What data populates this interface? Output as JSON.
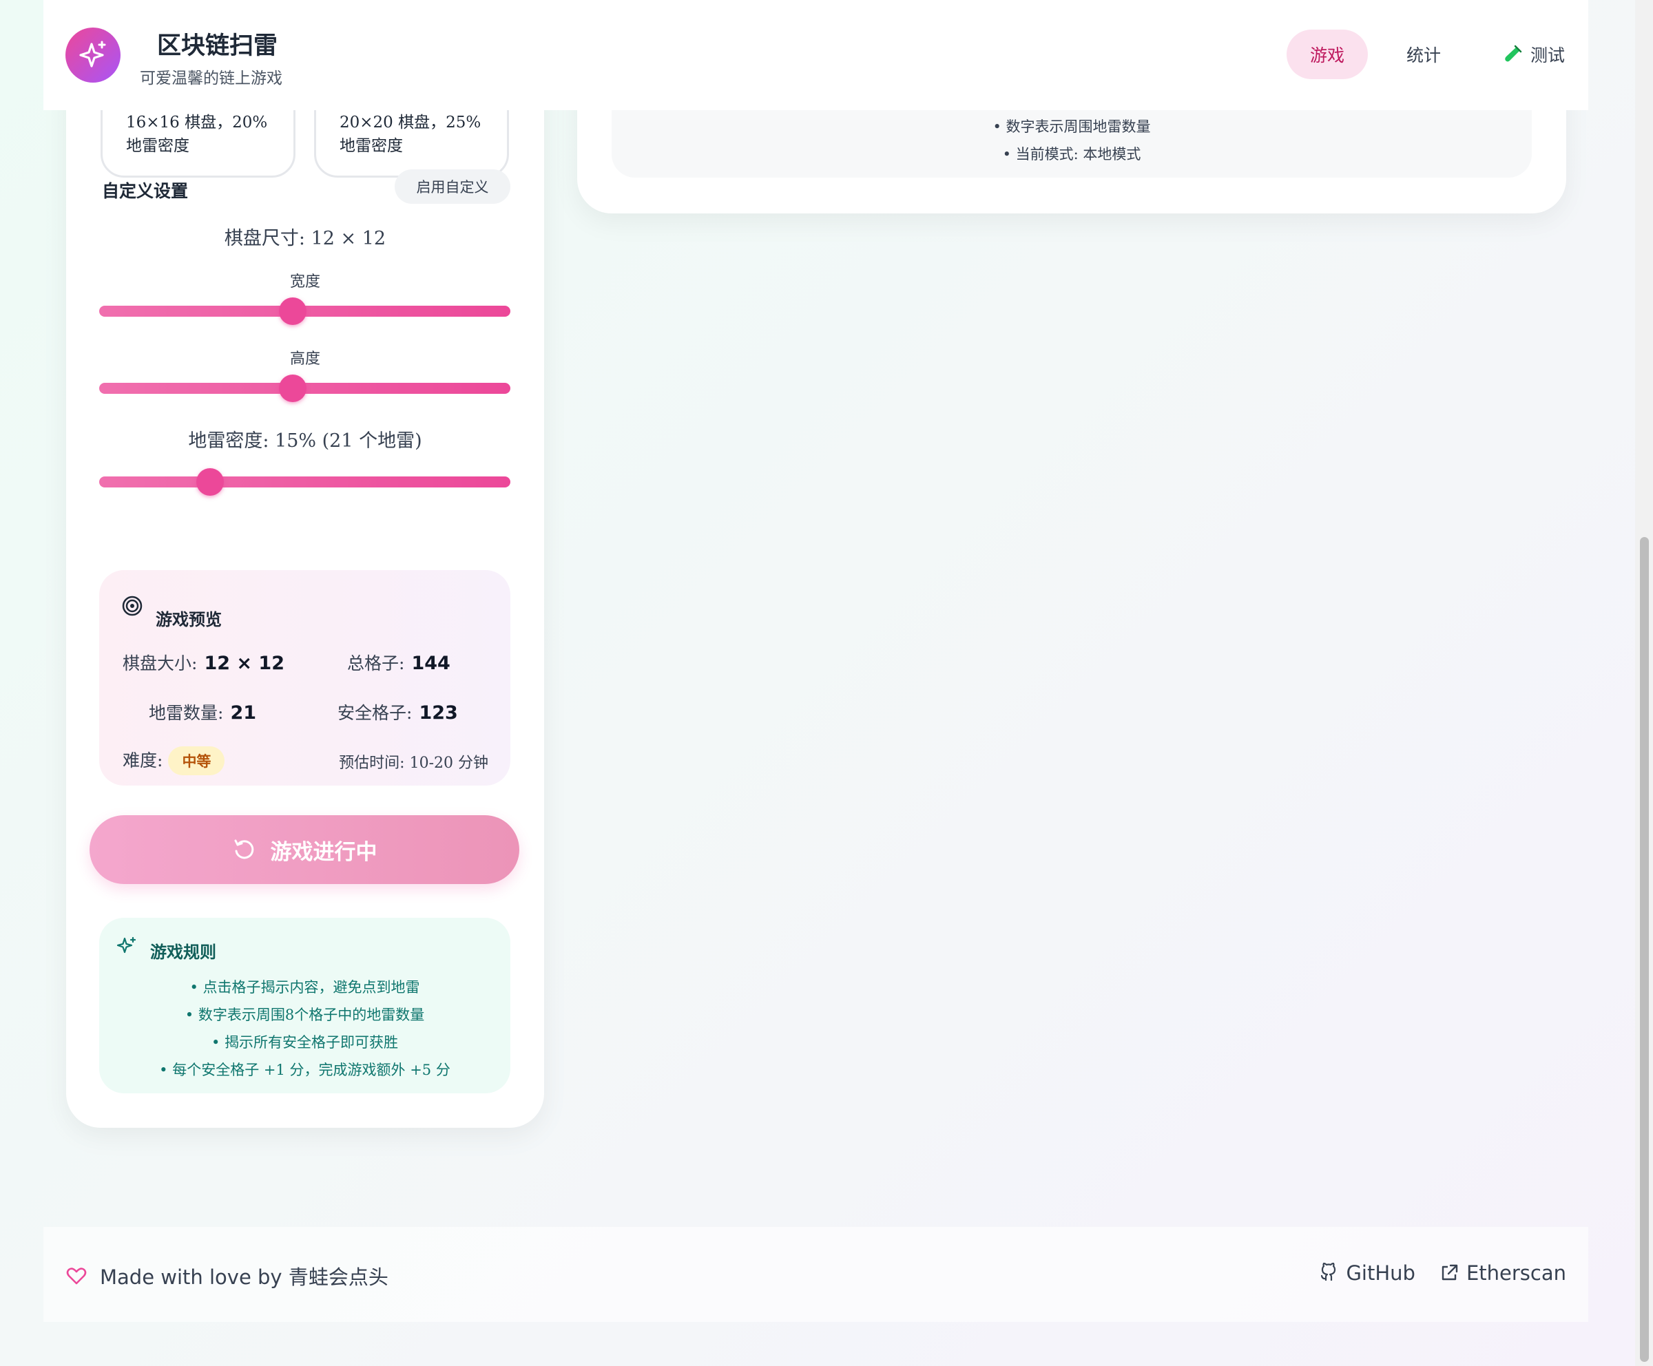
{
  "header": {
    "title": "区块链扫雷",
    "subtitle": "可爱温馨的链上游戏",
    "nav": [
      {
        "label": "游戏",
        "active": true
      },
      {
        "label": "统计",
        "active": false
      },
      {
        "label": "测试",
        "active": false,
        "icon": "test-tube-icon"
      }
    ]
  },
  "presets": [
    {
      "desc_line1": "16×16 棋盘，20%",
      "desc_line2": "地雷密度"
    },
    {
      "desc_line1": "20×20 棋盘，25%",
      "desc_line2": "地雷密度"
    }
  ],
  "custom": {
    "title": "自定义设置",
    "enable_label": "启用自定义",
    "board_size_label": "棋盘尺寸: 12 × 12",
    "width_label": "宽度",
    "height_label": "高度",
    "width_value": 12,
    "height_value": 12,
    "width_fraction": 0.47,
    "height_fraction": 0.47,
    "density_label": "地雷密度: 15% (21 个地雷)",
    "density_fraction": 0.27
  },
  "preview": {
    "title": "游戏预览",
    "board_size_label": "棋盘大小:",
    "board_size_value": "12 × 12",
    "total_cells_label": "总格子:",
    "total_cells_value": "144",
    "mine_count_label": "地雷数量:",
    "mine_count_value": "21",
    "safe_cells_label": "安全格子:",
    "safe_cells_value": "123",
    "difficulty_label": "难度:",
    "difficulty_value": "中等",
    "estimated_time": "预估时间: 10-20 分钟"
  },
  "start_button": {
    "label": "游戏进行中"
  },
  "rules": {
    "title": "游戏规则",
    "items": [
      "• 点击格子揭示内容，避免点到地雷",
      "• 数字表示周围8个格子中的地雷数量",
      "• 揭示所有安全格子即可获胜",
      "• 每个安全格子 +1 分，完成游戏额外 +5 分"
    ]
  },
  "right_panel": {
    "lines": [
      "• 数字表示周围地雷数量",
      "• 当前模式: 本地模式"
    ]
  },
  "footer": {
    "made_with": "Made with love by 青蛙会点头",
    "github": "GitHub",
    "etherscan": "Etherscan"
  },
  "colors": {
    "accent": "#ec4899",
    "accent_light": "#fbe1ee",
    "rules_bg": "#edfbf6",
    "rules_text": "#0f766e"
  }
}
